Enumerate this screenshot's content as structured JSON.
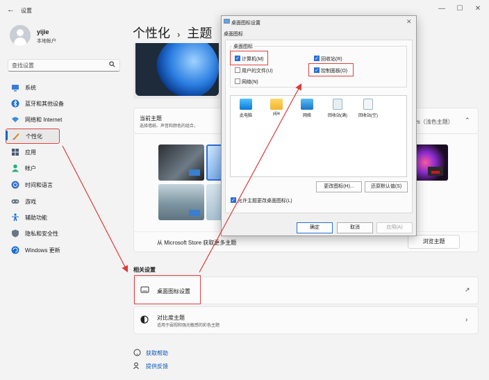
{
  "window": {
    "title": "设置",
    "back": "←",
    "min": "—",
    "max": "☐",
    "close": "✕"
  },
  "user": {
    "name": "yijie",
    "account": "本地帐户"
  },
  "search": {
    "placeholder": "查找设置",
    "icon": "search-icon"
  },
  "sidebar": {
    "items": [
      {
        "label": "系统",
        "icon": "monitor-icon",
        "color": "#3a7bd5"
      },
      {
        "label": "蓝牙和其他设备",
        "icon": "bluetooth-icon",
        "color": "#1f6fd1"
      },
      {
        "label": "网络和 Internet",
        "icon": "wifi-icon",
        "color": "#3a8de0"
      },
      {
        "label": "个性化",
        "icon": "brush-icon",
        "color": "#e08a2a",
        "active": true
      },
      {
        "label": "应用",
        "icon": "apps-icon",
        "color": "#4a5a70"
      },
      {
        "label": "帐户",
        "icon": "person-icon",
        "color": "#2bb17a"
      },
      {
        "label": "时间和语言",
        "icon": "globe-clock-icon",
        "color": "#3570c8"
      },
      {
        "label": "游戏",
        "icon": "gamepad-icon",
        "color": "#6b7888"
      },
      {
        "label": "辅助功能",
        "icon": "accessibility-icon",
        "color": "#1a6cd0"
      },
      {
        "label": "隐私和安全性",
        "icon": "shield-icon",
        "color": "#6b7686"
      },
      {
        "label": "Windows 更新",
        "icon": "update-icon",
        "color": "#1a6cd0"
      }
    ]
  },
  "main": {
    "breadcrumb_parent": "个性化",
    "breadcrumb_sep": "›",
    "breadcrumb_current": "主题",
    "current_theme": {
      "title": "当前主题",
      "subtitle": "选择墙纸、声音和颜色的组合，",
      "value": "ws（浅色主题）",
      "chevron": "⌃"
    },
    "store_text": "从 Microsoft Store 获取更多主题",
    "browse_button": "浏览主题",
    "related_title": "相关设置",
    "desktop_icon_settings": "桌面图标设置",
    "open_icon": "↗",
    "contrast": {
      "title": "对比度主题",
      "subtitle": "适用于弱视和强光敏感的彩色主题",
      "chevron": "›"
    },
    "help": "获取帮助",
    "feedback": "提供反馈"
  },
  "dialog": {
    "title": "桌面图标设置",
    "close": "✕",
    "tab": "桌面图标",
    "group_title": "桌面图标",
    "checkboxes": [
      {
        "label": "计算机(M)",
        "checked": true
      },
      {
        "label": "回收站(R)",
        "checked": true
      },
      {
        "label": "用户的文件(U)",
        "checked": false
      },
      {
        "label": "控制面板(O)",
        "checked": true
      },
      {
        "label": "网络(N)",
        "checked": false
      }
    ],
    "icons": [
      {
        "label": "此电脑",
        "icon": "computer-icon"
      },
      {
        "label": "yijie",
        "icon": "folder-icon"
      },
      {
        "label": "网络",
        "icon": "network-icon"
      },
      {
        "label": "回收站(满)",
        "icon": "recycle-bin-full-icon"
      },
      {
        "label": "回收站(空)",
        "icon": "recycle-bin-empty-icon"
      }
    ],
    "change_icon": "更改图标(H)...",
    "restore_default": "还原默认值(S)",
    "allow_themes": "允许主题更改桌面图标(L)",
    "allow_themes_checked": true,
    "ok": "确定",
    "cancel": "取消",
    "apply": "应用(A)"
  }
}
